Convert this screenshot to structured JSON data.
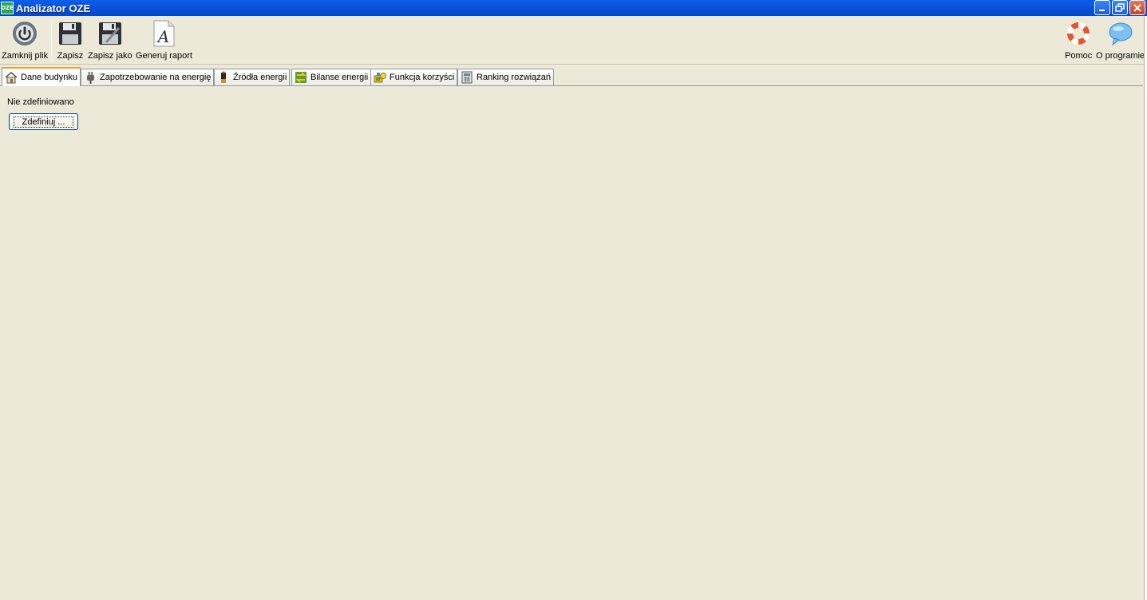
{
  "window": {
    "title": "Analizator OZE",
    "logo_text": "OZE",
    "controls": {
      "minimize": "_",
      "restore": "❐",
      "close": "✕"
    }
  },
  "toolbar": {
    "close_file": {
      "label": "Zamknij plik",
      "icon": "power-icon"
    },
    "save": {
      "label": "Zapisz",
      "icon": "floppy-disk-icon"
    },
    "save_as": {
      "label": "Zapisz jako",
      "icon": "floppy-disk-pen-icon"
    },
    "generate_report": {
      "label": "Generuj raport",
      "icon": "document-a-icon"
    },
    "help": {
      "label": "Pomoc",
      "icon": "lifebuoy-icon"
    },
    "about": {
      "label": "O programie",
      "icon": "speech-bubble-icon"
    }
  },
  "tabs": [
    {
      "label": "Dane budynku",
      "icon": "house-icon",
      "active": true
    },
    {
      "label": "Zapotrzebowanie na energię",
      "icon": "plug-icon",
      "active": false
    },
    {
      "label": "Źródła energii",
      "icon": "battery-icon",
      "active": false
    },
    {
      "label": "Bilanse energii",
      "icon": "exchange-arrows-icon",
      "active": false
    },
    {
      "label": "Funkcja korzyści",
      "icon": "money-icon",
      "active": false
    },
    {
      "label": "Ranking rozwiązań",
      "icon": "calculator-icon",
      "active": false
    }
  ],
  "panel": {
    "status_text": "Nie zdefiniowano",
    "define_button": "Zdefiniuj ..."
  },
  "colors": {
    "titlebar": "#0a5fe8",
    "background": "#ece9d8",
    "active_tab_accent": "#f0a433"
  }
}
